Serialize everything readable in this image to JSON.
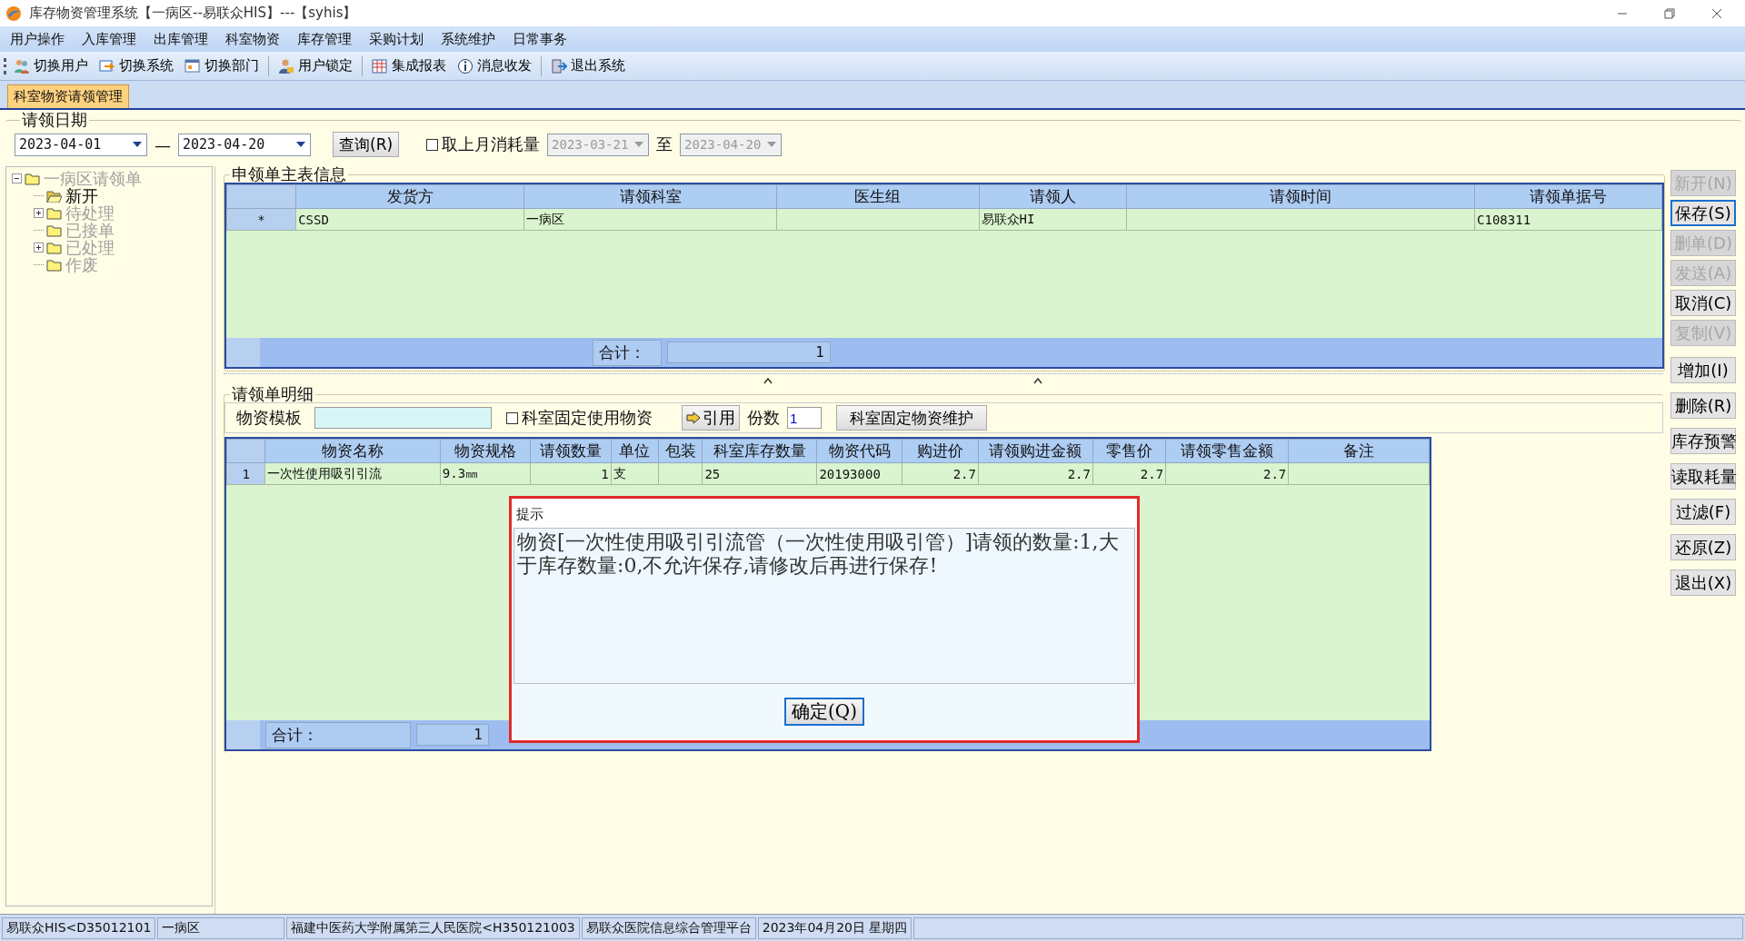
{
  "window": {
    "title": "库存物资管理系统【一病区--易联众HIS】---【syhis】"
  },
  "menu": [
    "用户操作",
    "入库管理",
    "出库管理",
    "科室物资",
    "库存管理",
    "采购计划",
    "系统维护",
    "日常事务"
  ],
  "toolbar": [
    "切换用户",
    "切换系统",
    "切换部门",
    "用户锁定",
    "集成报表",
    "消息收发",
    "退出系统"
  ],
  "tabs": [
    {
      "label": "科室物资请领管理",
      "selected": true
    }
  ],
  "date_filter": {
    "legend": "请领日期",
    "from": "2023-04-01",
    "separator": "—",
    "to": "2023-04-20",
    "query_button": "查询(R)",
    "last_month": {
      "label": "取上月消耗量",
      "checked": false
    },
    "last_from": "2023-03-21",
    "range_sep": "至",
    "last_to": "2023-04-20",
    "last_disabled": true
  },
  "tree": {
    "label": "一病区请领单",
    "expanded": true,
    "disabled": true,
    "children": [
      {
        "label": "新开",
        "selected": true,
        "disabled": false,
        "expandable": false
      },
      {
        "label": "待处理",
        "selected": false,
        "disabled": true,
        "expandable": true
      },
      {
        "label": "已接单",
        "selected": false,
        "disabled": true,
        "expandable": false
      },
      {
        "label": "已处理",
        "selected": false,
        "disabled": true,
        "expandable": true
      },
      {
        "label": "作废",
        "selected": false,
        "disabled": true,
        "expandable": false
      }
    ]
  },
  "master": {
    "legend": "申领单主表信息",
    "columns": [
      "发货方",
      "请领科室",
      "医生组",
      "请领人",
      "请领时间",
      "请领单据号"
    ],
    "rows": [
      {
        "marker": "*",
        "cells": [
          "CSSD",
          "一病区",
          "",
          "易联众HI",
          "",
          "C108311"
        ]
      }
    ],
    "footer": {
      "label": "合计：",
      "value": "1"
    }
  },
  "detail": {
    "legend": "请领单明细",
    "template_label": "物资模板",
    "fixed_check": {
      "label": "科室固定使用物资",
      "checked": false
    },
    "cite_button": "引用",
    "copies_label": "份数",
    "copies": "1",
    "maintain_button": "科室固定物资维护",
    "columns": [
      "物资名称",
      "物资规格",
      "请领数量",
      "单位",
      "包装",
      "科室库存数量",
      "物资代码",
      "购进价",
      "请领购进金额",
      "零售价",
      "请领零售金额",
      "备注"
    ],
    "rows": [
      {
        "marker": "1",
        "cells": [
          "一次性使用吸引引流",
          "9.3㎜",
          "1",
          "支",
          "",
          "25",
          "20193000",
          "2.7",
          "2.7",
          "2.7",
          "2.7",
          ""
        ]
      }
    ],
    "footer": {
      "label": "合计：",
      "value": "1"
    }
  },
  "dialog": {
    "title": "提示",
    "message": "物资[一次性使用吸引引流管（一次性使用吸引管）]请领的数量:1,大于库存数量:0,不允许保存,请修改后再进行保存!",
    "button": "确定(Q)"
  },
  "side_buttons": [
    {
      "label": "新开(N)",
      "disabled": true,
      "focused": false
    },
    {
      "label": "保存(S)",
      "disabled": false,
      "focused": true
    },
    {
      "label": "删单(D)",
      "disabled": true,
      "focused": false
    },
    {
      "label": "发送(A)",
      "disabled": true,
      "focused": false
    },
    {
      "label": "取消(C)",
      "disabled": false,
      "focused": false
    },
    {
      "label": "复制(V)",
      "disabled": true,
      "focused": false
    },
    {
      "label": "增加(I)",
      "disabled": false,
      "focused": false
    },
    {
      "label": "删除(R)",
      "disabled": false,
      "focused": false
    },
    {
      "label": "库存预警",
      "disabled": false,
      "focused": false
    },
    {
      "label": "读取耗量",
      "disabled": false,
      "focused": false
    },
    {
      "label": "过滤(F)",
      "disabled": false,
      "focused": false
    },
    {
      "label": "还原(Z)",
      "disabled": false,
      "focused": false
    },
    {
      "label": "退出(X)",
      "disabled": false,
      "focused": false
    }
  ],
  "status_bar": [
    "易联众HIS<D35012101",
    "一病区",
    "福建中医药大学附属第三人民医院<H350121003",
    "易联众医院信息综合管理平台",
    "2023年04月20日  星期四"
  ]
}
